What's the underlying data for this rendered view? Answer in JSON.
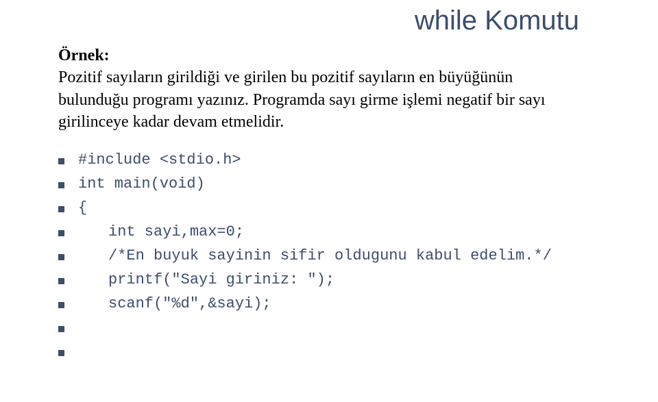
{
  "title": "while Komutu",
  "example_label": "Örnek:",
  "example_text_line1": "Pozitif sayıların girildiği ve girilen bu pozitif sayıların en büyüğünün",
  "example_text_line2": "bulunduğu programı yazınız. Programda sayı girme işlemi negatif bir sayı",
  "example_text_line3": "girilinceye kadar devam etmelidir.",
  "code_lines": [
    {
      "text": "#include <stdio.h>",
      "indent": false,
      "empty": false
    },
    {
      "text": "int main(void)",
      "indent": false,
      "empty": false
    },
    {
      "text": "{",
      "indent": false,
      "empty": false
    },
    {
      "text": "int sayi,max=0;",
      "indent": true,
      "empty": false
    },
    {
      "text": "/*En buyuk sayinin sifir oldugunu kabul edelim.*/",
      "indent": true,
      "empty": false
    },
    {
      "text": "printf(\"Sayi giriniz: \");",
      "indent": true,
      "empty": false
    },
    {
      "text": "scanf(\"%d\",&sayi);",
      "indent": true,
      "empty": false
    },
    {
      "text": "",
      "indent": false,
      "empty": true
    },
    {
      "text": "",
      "indent": false,
      "empty": true
    }
  ]
}
